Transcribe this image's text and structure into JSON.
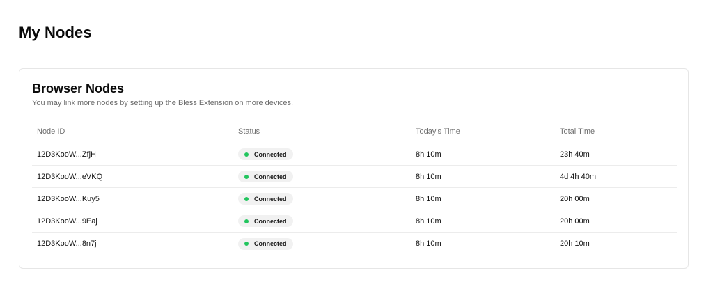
{
  "page": {
    "title": "My Nodes"
  },
  "card": {
    "title": "Browser Nodes",
    "subtitle": "You may link more nodes by setting up the Bless Extension on more devices."
  },
  "table": {
    "columns": [
      "Node ID",
      "Status",
      "Today's Time",
      "Total Time"
    ],
    "rows": [
      {
        "node_id": "12D3KooW...ZfjH",
        "status": "Connected",
        "today": "8h 10m",
        "total": "23h 40m"
      },
      {
        "node_id": "12D3KooW...eVKQ",
        "status": "Connected",
        "today": "8h 10m",
        "total": "4d 4h 40m"
      },
      {
        "node_id": "12D3KooW...Kuy5",
        "status": "Connected",
        "today": "8h 10m",
        "total": "20h 00m"
      },
      {
        "node_id": "12D3KooW...9Eaj",
        "status": "Connected",
        "today": "8h 10m",
        "total": "20h 00m"
      },
      {
        "node_id": "12D3KooW...8n7j",
        "status": "Connected",
        "today": "8h 10m",
        "total": "20h 10m"
      }
    ]
  },
  "colors": {
    "status_connected": "#22c55e"
  }
}
